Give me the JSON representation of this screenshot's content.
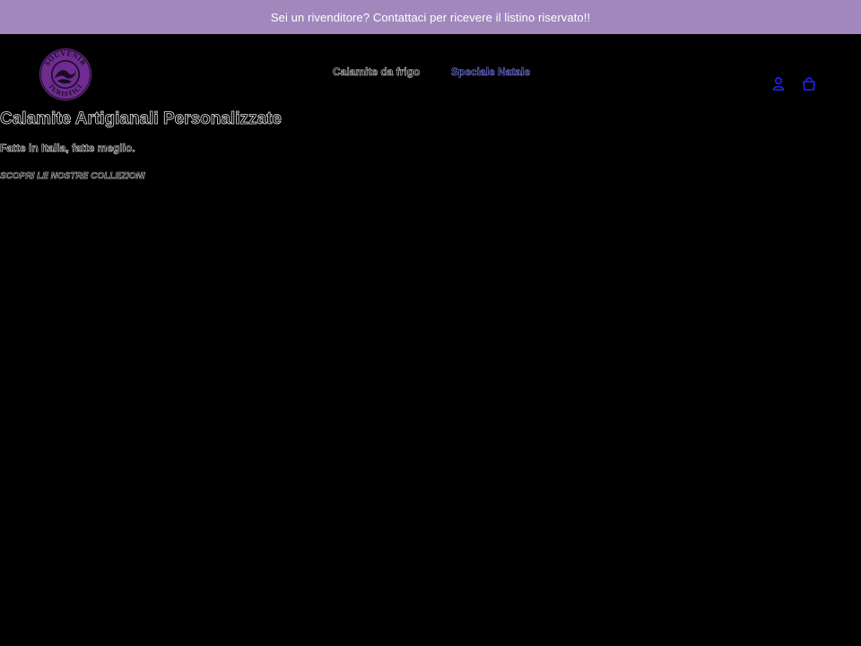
{
  "announcement": {
    "text": "Sei un rivenditore? Contattaci per ricevere il listino riservato!!"
  },
  "header": {
    "logo": {
      "top_text": "SOUVENIR",
      "bottom_text": "TURISTICI",
      "color": "#6e2c8f"
    },
    "nav": {
      "items": [
        {
          "label": "Calamite da frigo"
        },
        {
          "label": "Speciale Natale"
        }
      ]
    },
    "icons": {
      "account": "account-icon",
      "cart": "cart-icon",
      "color": "#2222ff"
    }
  },
  "hero": {
    "title": "Calamite Artigianali Personalizzate",
    "subtitle": "Fatte in Italia, fatte meglio.",
    "cta": "SCOPRI LE NOSTRE COLLEZIONI"
  },
  "colors": {
    "announcement_bg": "#a287bd",
    "page_bg": "#000000",
    "nav_active": "#7b83ff"
  }
}
